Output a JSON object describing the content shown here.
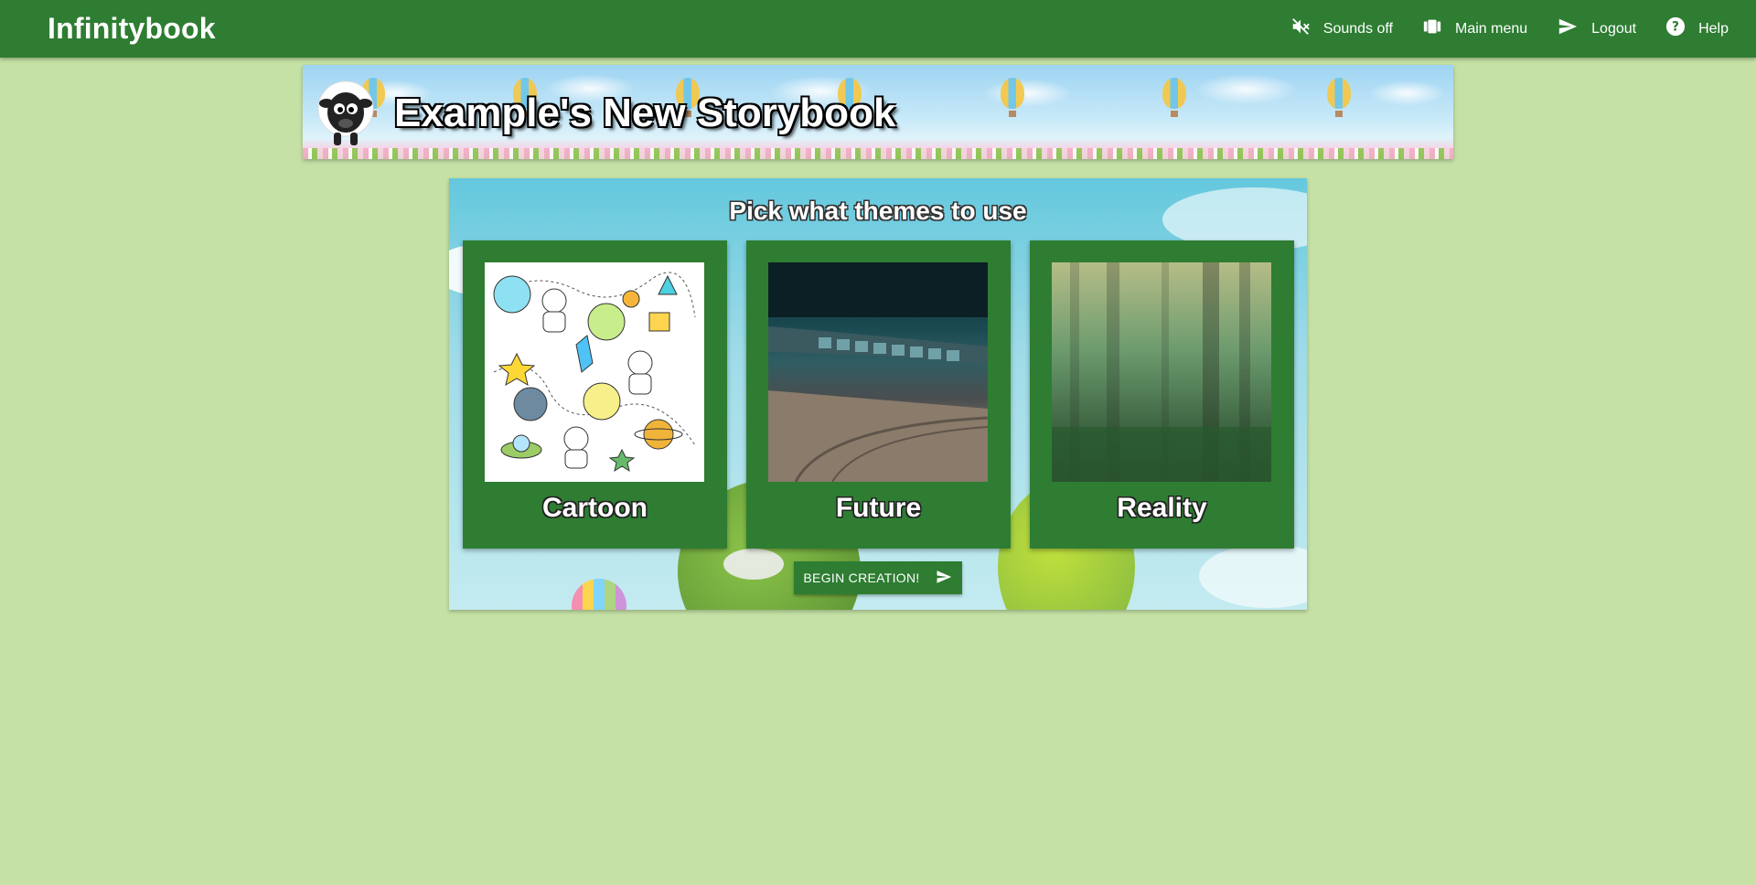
{
  "app": {
    "brand": "Infinitybook"
  },
  "nav": {
    "sounds": {
      "label": "Sounds off",
      "icon": "volume-off-icon"
    },
    "main_menu": {
      "label": "Main menu",
      "icon": "view-carousel-icon"
    },
    "logout": {
      "label": "Logout",
      "icon": "send-icon"
    },
    "help": {
      "label": "Help",
      "icon": "help-circle-icon"
    }
  },
  "banner": {
    "title": "Example's New Storybook",
    "logo": "sheep-avatar"
  },
  "themes": {
    "title": "Pick what themes to use",
    "cards": [
      {
        "label": "Cartoon",
        "image": "cartoon-space-doodles"
      },
      {
        "label": "Future",
        "image": "spaceship-corridor"
      },
      {
        "label": "Reality",
        "image": "misty-forest"
      }
    ],
    "begin_label": "BEGIN CREATION!"
  },
  "colors": {
    "primary": "#2e7d32",
    "background": "#c5e1a5"
  }
}
